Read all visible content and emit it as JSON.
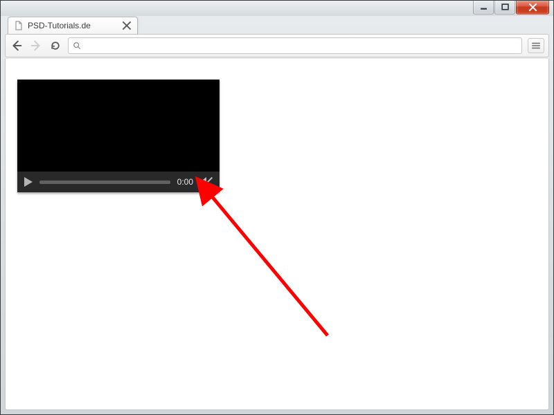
{
  "window": {
    "minimize_label": "Minimize",
    "maximize_label": "Maximize",
    "close_label": "Close"
  },
  "tab": {
    "title": "PSD-Tutorials.de"
  },
  "toolbar": {
    "back_label": "Back",
    "forward_label": "Forward",
    "reload_label": "Reload",
    "address_value": "",
    "address_placeholder": "",
    "menu_label": "Menu"
  },
  "video": {
    "play_label": "Play",
    "timecode": "0:00",
    "mute_label": "Mute"
  },
  "colors": {
    "annotation_arrow": "#ff0000"
  }
}
